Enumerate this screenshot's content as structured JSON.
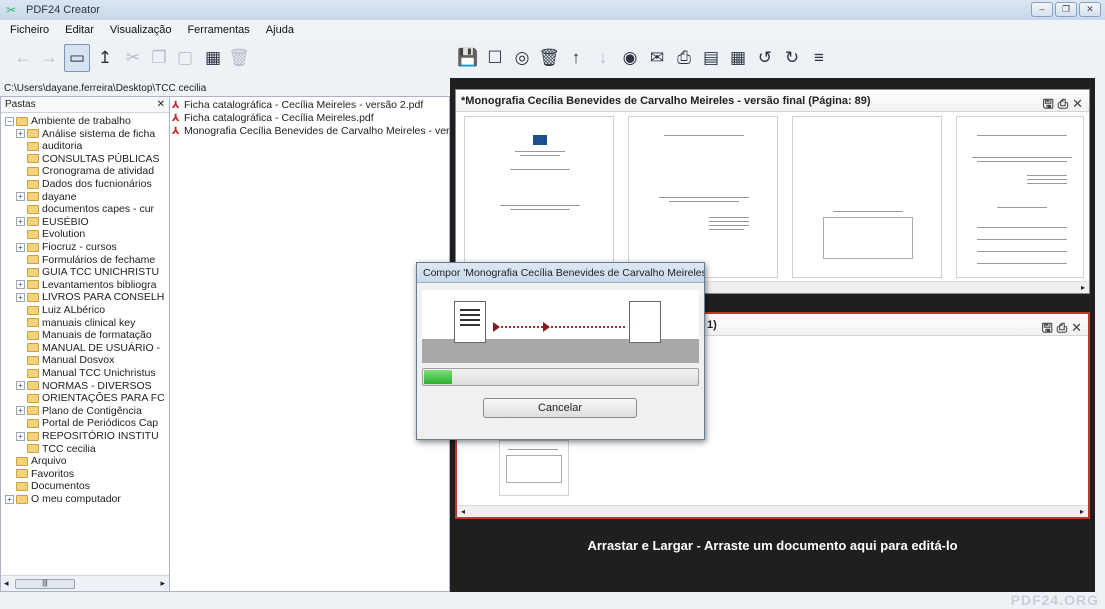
{
  "window": {
    "title": "PDF24 Creator",
    "controls": [
      "–",
      "❐",
      "✕"
    ]
  },
  "menu": [
    "Ficheiro",
    "Editar",
    "Visualização",
    "Ferramentas",
    "Ajuda"
  ],
  "path": "C:\\Users\\dayane.ferreira\\Desktop\\TCC cecilia",
  "left_panel": {
    "header": "Pastas",
    "close": "✕"
  },
  "tree": [
    {
      "label": "Ambiente de trabalho",
      "level": 0,
      "exp": "−"
    },
    {
      "label": "Análise sistema de ficha",
      "level": 1,
      "exp": "+"
    },
    {
      "label": "auditoria",
      "level": 1,
      "exp": ""
    },
    {
      "label": "CONSULTAS PÚBLICAS",
      "level": 1,
      "exp": ""
    },
    {
      "label": "Cronograma de atividad",
      "level": 1,
      "exp": ""
    },
    {
      "label": "Dados dos fucnionários",
      "level": 1,
      "exp": ""
    },
    {
      "label": "dayane",
      "level": 1,
      "exp": "+"
    },
    {
      "label": "documentos capes - cur",
      "level": 1,
      "exp": ""
    },
    {
      "label": "EUSÉBIO",
      "level": 1,
      "exp": "+"
    },
    {
      "label": "Evolution",
      "level": 1,
      "exp": ""
    },
    {
      "label": "Fiocruz - cursos",
      "level": 1,
      "exp": "+"
    },
    {
      "label": "Formulários de fechame",
      "level": 1,
      "exp": ""
    },
    {
      "label": "GUIA TCC UNICHRISTU",
      "level": 1,
      "exp": ""
    },
    {
      "label": "Levantamentos bibliogra",
      "level": 1,
      "exp": "+"
    },
    {
      "label": "LIVROS PARA CONSELH",
      "level": 1,
      "exp": "+"
    },
    {
      "label": "Luiz ALbérico",
      "level": 1,
      "exp": ""
    },
    {
      "label": "manuais clinical key",
      "level": 1,
      "exp": ""
    },
    {
      "label": "Manuais de formatação",
      "level": 1,
      "exp": ""
    },
    {
      "label": "MANUAL DE USUÁRIO -",
      "level": 1,
      "exp": ""
    },
    {
      "label": "Manual Dosvox",
      "level": 1,
      "exp": ""
    },
    {
      "label": "Manual TCC Unichristus",
      "level": 1,
      "exp": ""
    },
    {
      "label": "NORMAS - DIVERSOS",
      "level": 1,
      "exp": "+"
    },
    {
      "label": "ORIENTAÇÕES PARA FC",
      "level": 1,
      "exp": ""
    },
    {
      "label": "Plano de Contigência",
      "level": 1,
      "exp": "+"
    },
    {
      "label": "Portal de Periódicos Cap",
      "level": 1,
      "exp": ""
    },
    {
      "label": "REPOSITÓRIO INSTITU",
      "level": 1,
      "exp": "+"
    },
    {
      "label": "TCC cecilia",
      "level": 1,
      "exp": ""
    },
    {
      "label": "Arquivo",
      "level": 0,
      "exp": ""
    },
    {
      "label": "Favoritos",
      "level": 0,
      "exp": ""
    },
    {
      "label": "Documentos",
      "level": 0,
      "exp": ""
    },
    {
      "label": "O meu computador",
      "level": 0,
      "exp": "+"
    }
  ],
  "files": [
    "Ficha catalográfica - Cecília Meireles - versão 2.pdf",
    "Ficha catalográfica - Cecília Meireles.pdf",
    "Monografia Cecília Benevides de Carvalho Meireles - ver"
  ],
  "doc_top": {
    "title": "*Monografia Cecília Benevides de Carvalho Meireles - versão final (Página: 89)"
  },
  "doc_bottom": {
    "title_fragment": "1)"
  },
  "drop_hint": "Arrastar e Largar - Arraste um documento aqui para editá-lo",
  "dialog": {
    "title": "Compor 'Monografia Cecília Benevides de Carvalho Meireles -...",
    "progress": 0.1,
    "cancel": "Cancelar"
  },
  "statusbar": {
    "brand": "PDF24.ORG"
  },
  "colors": {
    "accent_red": "#c0392b",
    "progress_green": "#28b028",
    "dark_area": "#1f1f1f"
  }
}
